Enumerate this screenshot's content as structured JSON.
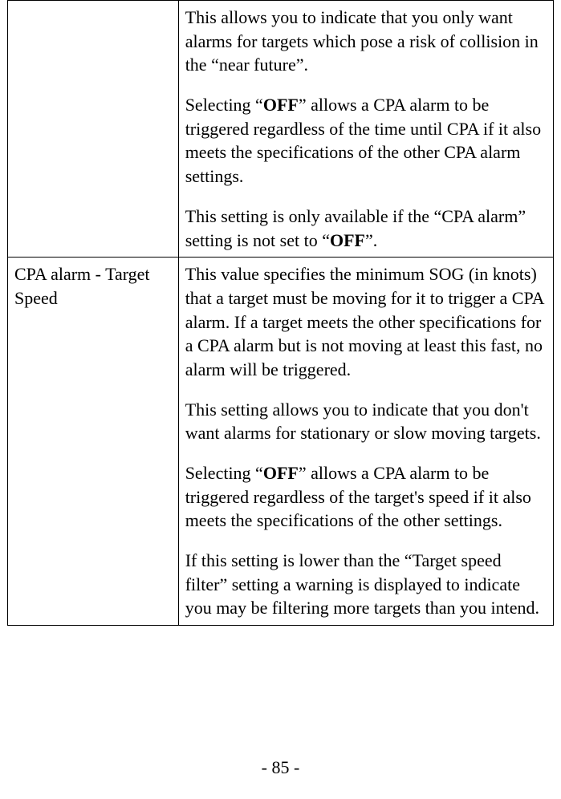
{
  "rows": [
    {
      "left": "",
      "paragraphs": [
        {
          "segments": [
            {
              "t": "This allows you to indicate that you only want alarms for targets which pose a risk of collision in the “near future”."
            }
          ]
        },
        {
          "segments": [
            {
              "t": "Selecting “"
            },
            {
              "t": "OFF",
              "bold": true
            },
            {
              "t": "” allows a CPA alarm to be triggered regardless of the time until CPA if it also meets the specifications of the other CPA alarm settings."
            }
          ]
        },
        {
          "segments": [
            {
              "t": "This setting is only available if the “CPA alarm” setting is not set to “"
            },
            {
              "t": "OFF",
              "bold": true
            },
            {
              "t": "”."
            }
          ]
        }
      ]
    },
    {
      "left": "CPA alarm - Target Speed",
      "paragraphs": [
        {
          "segments": [
            {
              "t": "This value specifies the minimum SOG (in knots) that a target must be moving for it to trigger a CPA alarm. If a target meets the other specifications for a CPA alarm but is not moving at least this fast, no alarm will be triggered."
            }
          ]
        },
        {
          "segments": [
            {
              "t": "This setting allows you to indicate that you don't want alarms for stationary or slow moving targets."
            }
          ]
        },
        {
          "segments": [
            {
              "t": "Selecting “"
            },
            {
              "t": "OFF",
              "bold": true
            },
            {
              "t": "” allows a CPA alarm to be triggered regardless of the target's speed if it also meets the specifications of the other settings."
            }
          ]
        },
        {
          "segments": [
            {
              "t": "If this setting is lower than the “Target speed filter” setting a warning is displayed to indicate you may be filtering more targets than you intend."
            }
          ]
        }
      ]
    }
  ],
  "page_number": "- 85 -"
}
